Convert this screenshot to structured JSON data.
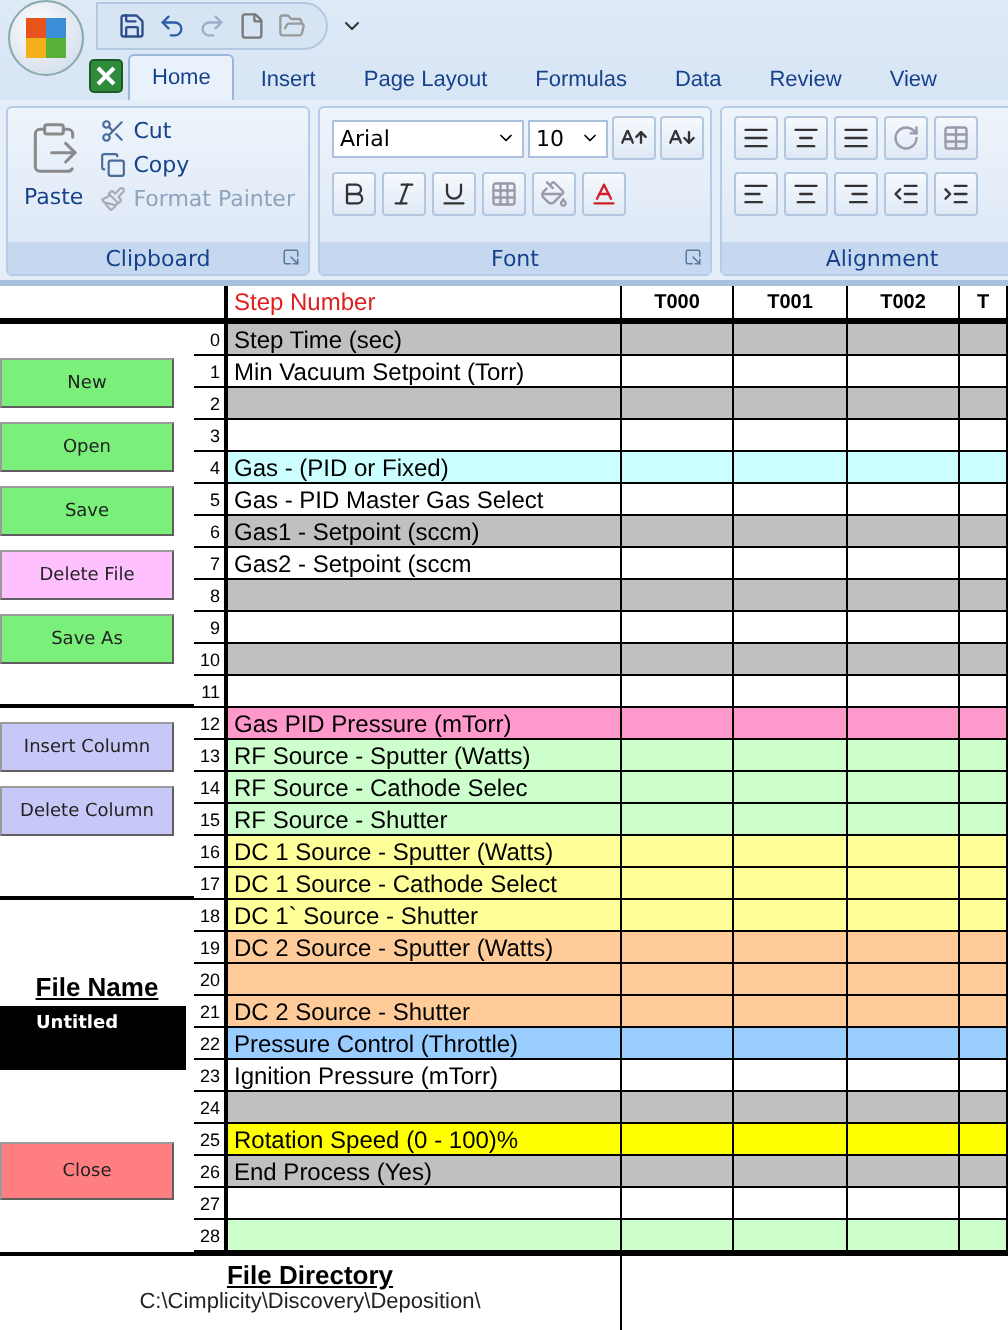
{
  "ribbon": {
    "tabs": [
      {
        "label": "Home",
        "selected": true
      },
      {
        "label": "Insert",
        "selected": false
      },
      {
        "label": "Page Layout",
        "selected": false
      },
      {
        "label": "Formulas",
        "selected": false
      },
      {
        "label": "Data",
        "selected": false
      },
      {
        "label": "Review",
        "selected": false
      },
      {
        "label": "View",
        "selected": false
      }
    ],
    "clipboard": {
      "title": "Clipboard",
      "paste": "Paste",
      "items": [
        {
          "kind": "cut",
          "label": "Cut",
          "disabled": false
        },
        {
          "kind": "copy",
          "label": "Copy",
          "disabled": false
        },
        {
          "kind": "painter",
          "label": "Format Painter",
          "disabled": true
        }
      ]
    },
    "font": {
      "title": "Font",
      "font_name": "Arial",
      "font_size": "10"
    },
    "alignment": {
      "title": "Alignment"
    }
  },
  "panel": {
    "top_buttons": [
      {
        "label": "New",
        "color": "#7af07a"
      },
      {
        "label": "Open",
        "color": "#7af07a"
      },
      {
        "label": "Save",
        "color": "#7af07a"
      },
      {
        "label": "Delete File",
        "color": "#ffc0ff"
      },
      {
        "label": "Save As",
        "color": "#7af07a"
      }
    ],
    "column_buttons": [
      {
        "label": "Insert Column",
        "color": "#c8c8f8"
      },
      {
        "label": "Delete Column",
        "color": "#c8c8f8"
      }
    ],
    "file_name": {
      "label": "File Name",
      "value": "Untitled"
    },
    "close_button": {
      "label": "Close",
      "color": "#ff7f80"
    }
  },
  "sheet": {
    "header_label": "Step Number",
    "columns": [
      "T000",
      "T001",
      "T002",
      "T"
    ],
    "rows": [
      {
        "number": "0",
        "label": "Step Time (sec)",
        "color": "#c0c0c0"
      },
      {
        "number": "1",
        "label": "Min Vacuum Setpoint (Torr)",
        "color": "#ffffff"
      },
      {
        "number": "2",
        "color": "#c0c0c0"
      },
      {
        "number": "3",
        "color": "#ffffff"
      },
      {
        "number": "4",
        "label": "Gas - (PID or Fixed)",
        "color": "#ccffff"
      },
      {
        "number": "5",
        "label": "Gas - PID Master Gas Select",
        "color": "#ffffff"
      },
      {
        "number": "6",
        "label": "Gas1 - Setpoint (sccm)",
        "color": "#c0c0c0"
      },
      {
        "number": "7",
        "label": "Gas2 - Setpoint (sccm",
        "color": "#ffffff"
      },
      {
        "number": "8",
        "color": "#c0c0c0"
      },
      {
        "number": "9",
        "color": "#ffffff"
      },
      {
        "number": "10",
        "color": "#c0c0c0"
      },
      {
        "number": "11",
        "color": "#ffffff"
      },
      {
        "number": "12",
        "label": "Gas PID Pressure (mTorr)",
        "color": "#ff99cc"
      },
      {
        "number": "13",
        "label": "RF Source - Sputter (Watts)",
        "color": "#ccffcc"
      },
      {
        "number": "14",
        "label": "RF Source - Cathode Selec",
        "color": "#ccffcc"
      },
      {
        "number": "15",
        "label": "RF Source - Shutter",
        "color": "#ccffcc"
      },
      {
        "number": "16",
        "label": "DC 1 Source - Sputter (Watts)",
        "color": "#ffff99"
      },
      {
        "number": "17",
        "label": "DC 1 Source - Cathode Select",
        "color": "#ffff99"
      },
      {
        "number": "18",
        "label": "DC 1` Source - Shutter",
        "color": "#ffff99"
      },
      {
        "number": "19",
        "label": "DC 2 Source - Sputter (Watts)",
        "color": "#ffcc99"
      },
      {
        "number": "20",
        "color": "#ffcc99"
      },
      {
        "number": "21",
        "label": "DC 2 Source - Shutter",
        "color": "#ffcc99"
      },
      {
        "number": "22",
        "label": "Pressure Control (Throttle)",
        "color": "#99ccff"
      },
      {
        "number": "23",
        "label": "Ignition Pressure (mTorr)",
        "color": "#ffffff"
      },
      {
        "number": "24",
        "color": "#c0c0c0"
      },
      {
        "number": "25",
        "label": "Rotation Speed (0 - 100)%",
        "color": "#ffff00"
      },
      {
        "number": "26",
        "label": "End Process (Yes)",
        "color": "#c0c0c0"
      },
      {
        "number": "27",
        "color": "#ffffff"
      },
      {
        "number": "28",
        "color": "#ccffcc"
      }
    ]
  },
  "footer": {
    "label": "File Directory",
    "path": "C:\\Cimplicity\\Discovery\\Deposition\\"
  }
}
